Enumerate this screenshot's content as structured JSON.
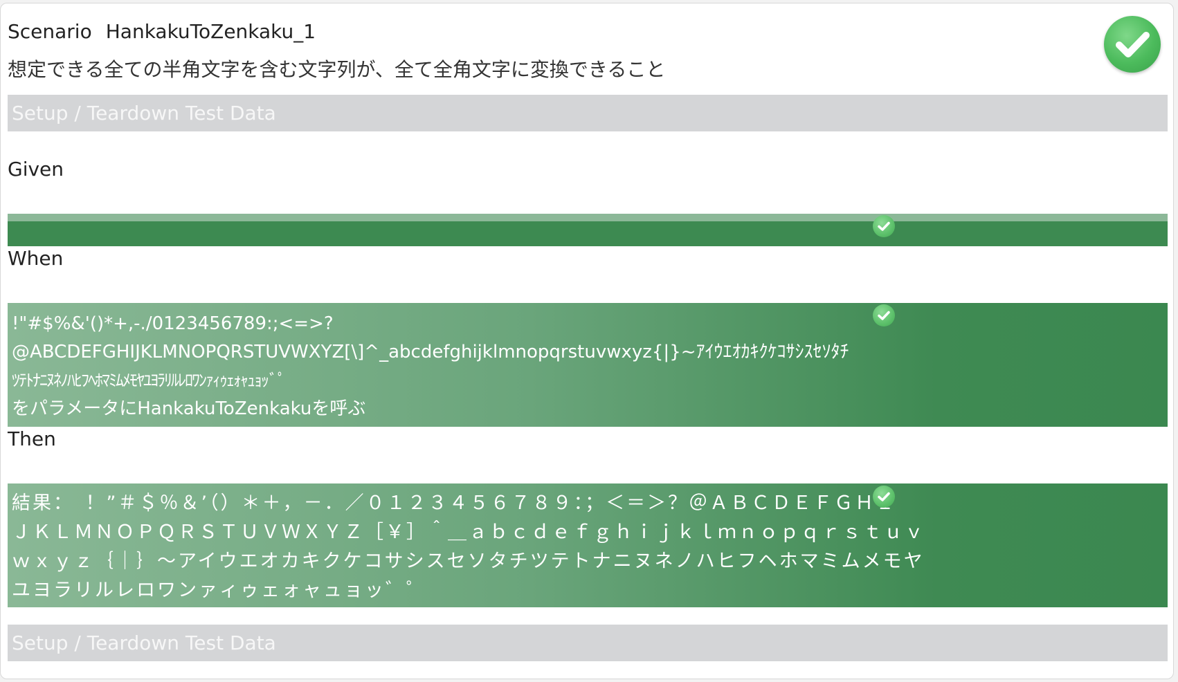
{
  "scenario": {
    "keyword": "Scenario",
    "name": "HankakuToZenkaku_1",
    "description": "想定できる全ての半角文字を含む文字列が、全て全角文字に変換できること",
    "status_icon": "check-circle-icon",
    "status_color": "#4cbb5c"
  },
  "setup_top": {
    "label": "Setup / Teardown Test Data"
  },
  "given": {
    "label": "Given",
    "text": "",
    "status_icon": "check-circle-icon"
  },
  "when": {
    "label": "When",
    "lines": [
      " !\"#$%&'()*+,-./0123456789:;<=>?",
      "@ABCDEFGHIJKLMNOPQRSTUVWXYZ[\\]^_abcdefghijklmnopqrstuvwxyz{|}~ｱｲｳｴｵｶｷｸｹｺｻｼｽｾｿﾀﾁ",
      "ﾂﾃﾄﾅﾆﾇﾈﾉﾊﾋﾌﾍﾎﾏﾐﾑﾒﾓﾔﾕﾖﾗﾘﾙﾚﾛﾜﾝｧｨｩｪｫｬｭｮｯﾞﾟ",
      " をパラメータにHankakuToZenkakuを呼ぶ"
    ],
    "status_icon": "check-circle-icon"
  },
  "then": {
    "label": "Then",
    "lines": [
      "結果：　！”＃＄％＆’（）＊＋，－．／０１２３４５６７８９：；＜＝＞？＠ＡＢＣＤＥＦＧＨＩ",
      "ＪＫＬＭＮＯＰＱＲＳＴＵＶＷＸＹＺ［￥］＾＿ａｂｃｄｅｆｇｈｉｊｋｌｍｎｏｐｑｒｓｔｕｖ",
      "ｗｘｙｚ｛｜｝～アイウエオカキクケコサシスセソタチツテトナニヌネノハヒフヘホマミムメモヤ",
      "ユヨラリルレロワンァィゥェォャュョッ゛゜"
    ],
    "status_icon": "check-circle-icon"
  },
  "setup_bottom": {
    "label": "Setup / Teardown Test Data"
  },
  "colors": {
    "step_pass_dark": "#3d8a51",
    "step_pass_light": "#8ab896",
    "setup_bar": "#d4d5d7"
  }
}
